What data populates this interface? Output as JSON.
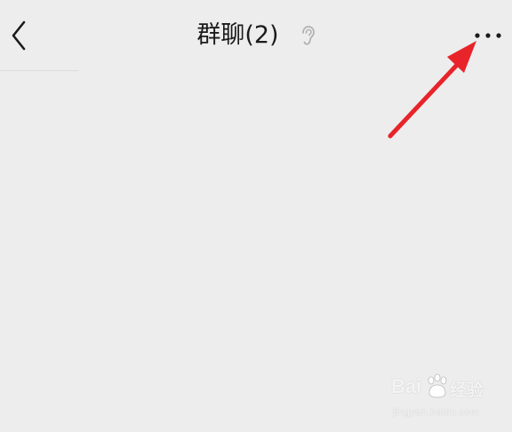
{
  "header": {
    "title": "群聊(2)",
    "back_icon": "chevron-left-icon",
    "mute_icon": "ear-icon",
    "more_icon": "more-dots-icon"
  },
  "annotation": {
    "arrow_color": "#e8232a",
    "points_to": "more-button"
  },
  "watermark": {
    "brand": "Bai",
    "brand_suffix": "经验",
    "url": "jingyan.baidu.com"
  },
  "colors": {
    "background": "#ededed",
    "title_text": "#1b1b1b",
    "icon_gray": "#b2b2b2"
  }
}
